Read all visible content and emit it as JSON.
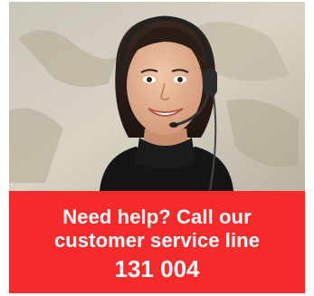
{
  "banner": {
    "photo": {
      "subject": "customer-service-agent-with-headset"
    },
    "cta": {
      "line1": "Need help? Call our",
      "line2": "customer service line",
      "phone": "131 004",
      "background_color": "#f52b2b",
      "text_color": "#ffffff"
    }
  }
}
